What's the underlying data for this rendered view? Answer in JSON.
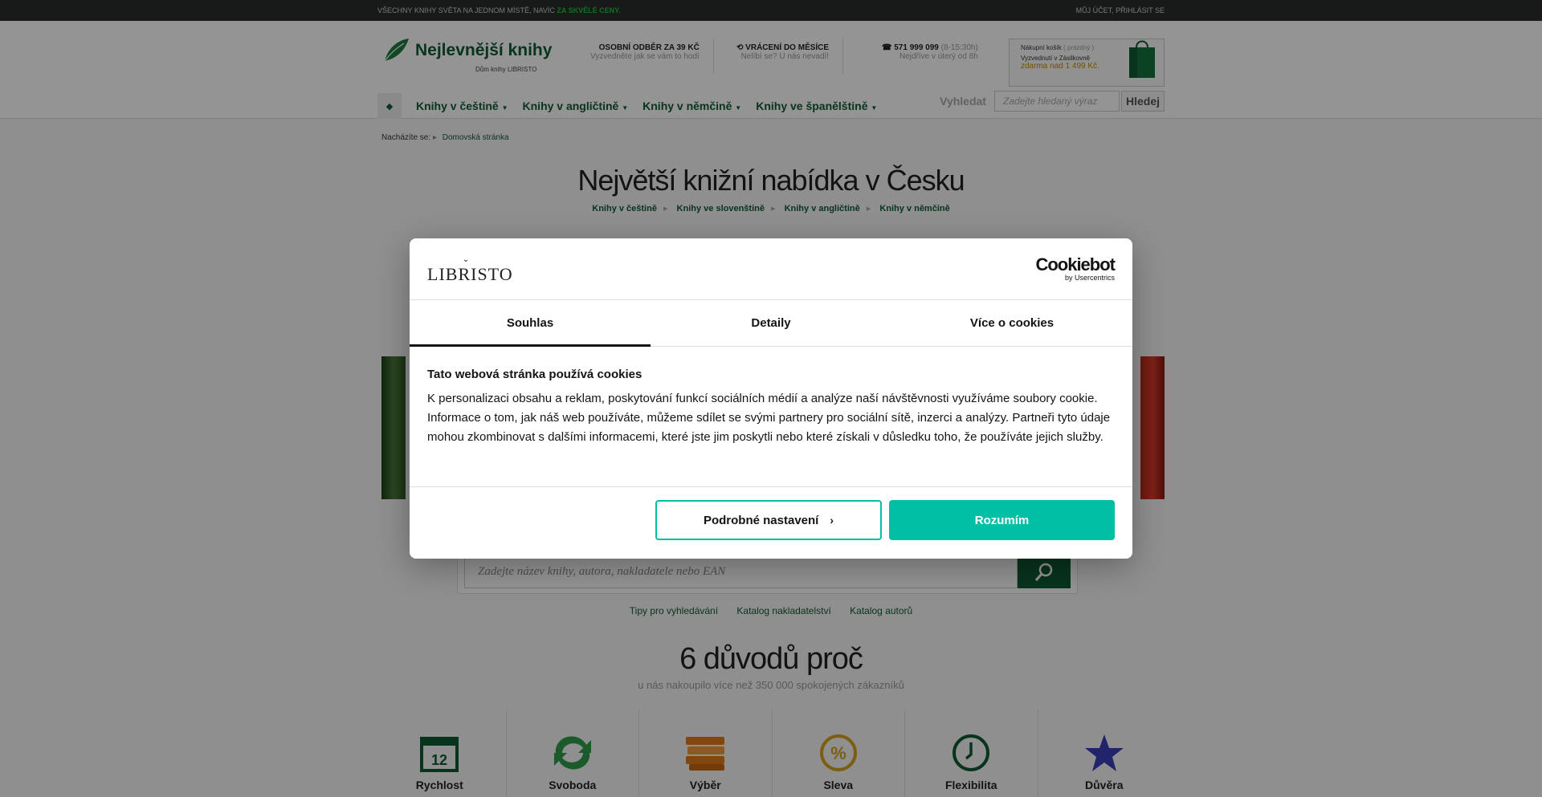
{
  "topbar": {
    "left_text": "Všechny knihy světa na jednom místě, navíc",
    "left_highlight": "za skvělé ceny.",
    "my_account": "Můj účet,",
    "login": "Přihlásit se"
  },
  "header": {
    "logo_title": "Nejlevnější knihy",
    "logo_sub": "Dům knihy LIBRISTO",
    "info": [
      {
        "title": "Osobní odběr za 39 Kč",
        "sub": "Vyzvedněte jak se vám to hodí"
      },
      {
        "title": "Vrácení do měsíce",
        "sub": "Nelíbí se? U nás nevadí!"
      },
      {
        "title": "571 999 099",
        "hours": "(8-15:30h)",
        "sub": "Nejdříve v úterý od 8h"
      }
    ],
    "cart": {
      "title": "Nákupní košík",
      "state": "( prázdný )",
      "line1": "Vyzvednutí v Zásilkovně",
      "line2": "zdarma nad 1 499 Kč."
    }
  },
  "nav": {
    "items": [
      "Knihy v češtině",
      "Knihy v angličtině",
      "Knihy v němčině",
      "Knihy ve španělštině"
    ],
    "search_label": "Vyhledat",
    "search_placeholder": "Zadejte hledaný výraz",
    "search_button": "Hledej"
  },
  "breadcrumb": {
    "label": "Nacházíte se:",
    "home": "Domovská stránka"
  },
  "hero": {
    "title": "Největší knižní nabídka v Česku",
    "links": [
      "Knihy v češtině",
      "Knihy ve slovenštině",
      "Knihy v angličtině",
      "Knihy v němčině"
    ]
  },
  "main_search": {
    "placeholder": "Zadejte název knihy, autora, nakladatele nebo EAN",
    "links": [
      "Tipy pro vyhledávání",
      "Katalog nakladatelství",
      "Katalog autorů"
    ]
  },
  "reasons": {
    "title": "6 důvodů proč",
    "subtitle": "u nás nakoupilo více než 350 000 spokojených zákazníků",
    "items": [
      {
        "label": "Rychlost",
        "icon": "calendar-icon",
        "color": "#0e5a32"
      },
      {
        "label": "Svoboda",
        "icon": "recycle-icon",
        "color": "#2e9c4a"
      },
      {
        "label": "Výběr",
        "icon": "book-stack-icon",
        "color": "#e07b1a"
      },
      {
        "label": "Sleva",
        "icon": "percent-icon",
        "color": "#d6a21c"
      },
      {
        "label": "Flexibilita",
        "icon": "clock-icon",
        "color": "#0e5a32"
      },
      {
        "label": "Důvěra",
        "icon": "star-icon",
        "color": "#3b3fb8"
      }
    ]
  },
  "cookie_dialog": {
    "brand": "LIBRISTO",
    "provider": "Cookiebot",
    "provider_sub": "by Usercentrics",
    "tabs": [
      "Souhlas",
      "Detaily",
      "Více o cookies"
    ],
    "heading": "Tato webová stránka používá cookies",
    "text": "K personalizaci obsahu a reklam, poskytování funkcí sociálních médií a analýze naší návštěvnosti využíváme soubory cookie. Informace o tom, jak náš web používáte, můžeme sdílet se svými partnery pro sociální sítě, inzerci a analýzy. Partneři tyto údaje mohou zkombinovat s dalšími informacemi, které jste jim poskytli nebo které získali v důsledku toho, že používáte jejich služby.",
    "btn_details": "Podrobné nastavení",
    "btn_accept": "Rozumím",
    "accent": "#00bfa5"
  }
}
